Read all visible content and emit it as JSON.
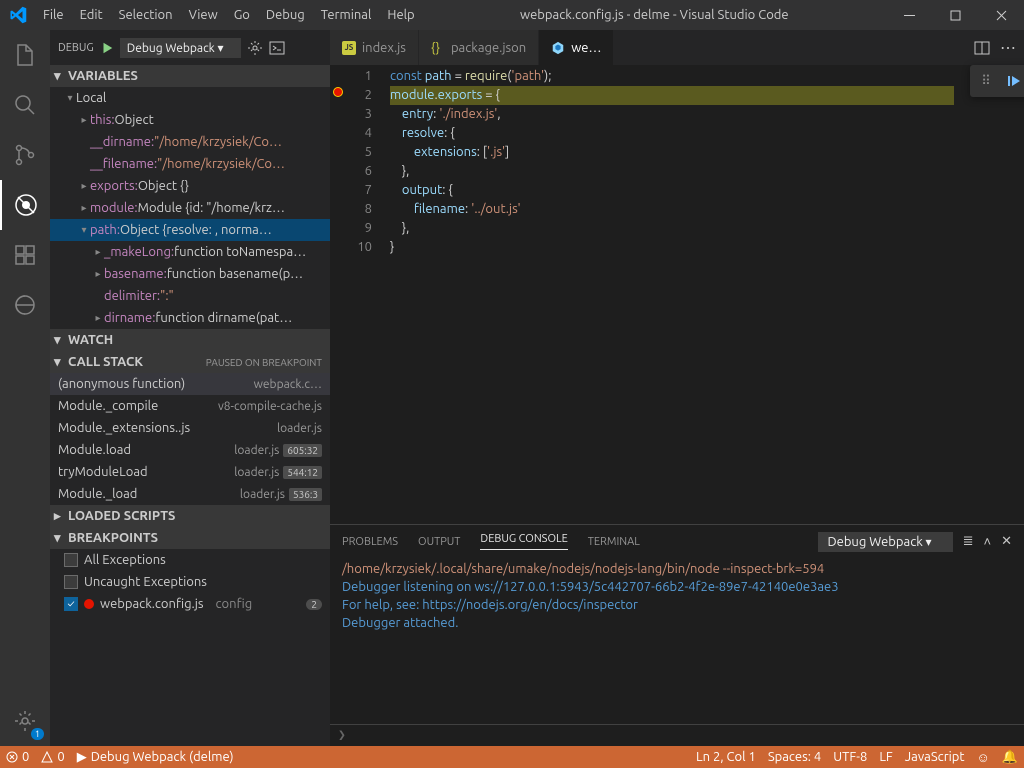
{
  "titlebar": {
    "title": "webpack.config.js - delme - Visual Studio Code",
    "menus": [
      "File",
      "Edit",
      "Selection",
      "View",
      "Go",
      "Debug",
      "Terminal",
      "Help"
    ]
  },
  "sidebar": {
    "debug_label": "DEBUG",
    "config": "Debug Webpack ▾"
  },
  "sections": {
    "variables": "VARIABLES",
    "watch": "WATCH",
    "callstack": "CALL STACK",
    "callstack_state": "PAUSED ON BREAKPOINT",
    "loaded": "LOADED SCRIPTS",
    "breakpoints": "BREAKPOINTS"
  },
  "variables": {
    "local": "Local",
    "rows": [
      {
        "n": "this:",
        "v": " Object"
      },
      {
        "n": "__dirname:",
        "v": " \"/home/krzysiek/Co…",
        "str": true
      },
      {
        "n": "__filename:",
        "v": " \"/home/krzysiek/Co…",
        "str": true
      },
      {
        "n": "exports:",
        "v": " Object {}"
      },
      {
        "n": "module:",
        "v": " Module {id: \"/home/krz…"
      },
      {
        "n": "path:",
        "v": " Object {resolve: , norma…",
        "sel": true,
        "exp": true
      },
      {
        "n": "_makeLong:",
        "v": " function toNamespa…",
        "sub": true
      },
      {
        "n": "basename:",
        "v": " function basename(p…",
        "sub": true
      },
      {
        "n": "delimiter:",
        "v": " \":\"",
        "sub": true,
        "str": true
      },
      {
        "n": "dirname:",
        "v": " function dirname(pat…",
        "sub": true
      }
    ]
  },
  "callstack": [
    {
      "n": "(anonymous function)",
      "f": "webpack.c…",
      "sel": true
    },
    {
      "n": "Module._compile",
      "f": "v8-compile-cache.js"
    },
    {
      "n": "Module._extensions..js",
      "f": "loader.js"
    },
    {
      "n": "Module.load",
      "f": "loader.js",
      "p": "605:32"
    },
    {
      "n": "tryModuleLoad",
      "f": "loader.js",
      "p": "544:12"
    },
    {
      "n": "Module._load",
      "f": "loader.js",
      "p": "536:3"
    }
  ],
  "breakpoints": {
    "all": "All Exceptions",
    "allchk": false,
    "uncaught": "Uncaught Exceptions",
    "uncaughtchk": false,
    "file": "webpack.config.js",
    "filecfg": "config",
    "filechk": true,
    "badge": "2"
  },
  "tabs": [
    {
      "label": "index.js",
      "icon": "js"
    },
    {
      "label": "package.json",
      "icon": "json"
    },
    {
      "label": "we…",
      "icon": "webpack",
      "active": true
    }
  ],
  "code": {
    "lines": [
      1,
      2,
      3,
      4,
      5,
      6,
      7,
      8,
      9,
      10
    ],
    "l1": {
      "a": "const",
      "b": " path ",
      "c": "=",
      "d": " require",
      "e": "(",
      "f": "'path'",
      "g": ");"
    },
    "l2": {
      "a": "module",
      "b": ".",
      "c": "exports",
      "d": " = ",
      "e": "{"
    },
    "l3": {
      "a": "    entry",
      "b": ": ",
      "c": "'./index.js'",
      "d": ","
    },
    "l4": {
      "a": "    resolve",
      "b": ": ",
      "c": "{"
    },
    "l5": {
      "a": "        extensions",
      "b": ": [",
      "c": "'.js'",
      "d": "]"
    },
    "l6": {
      "a": "    },"
    },
    "l7": {
      "a": "    output",
      "b": ": ",
      "c": "{"
    },
    "l8": {
      "a": "        filename",
      "b": ": ",
      "c": "'../out.js'"
    },
    "l9": {
      "a": "    },"
    },
    "l10": {
      "a": "}"
    }
  },
  "panel": {
    "tabs": [
      "PROBLEMS",
      "OUTPUT",
      "DEBUG CONSOLE",
      "TERMINAL"
    ],
    "selector": "Debug Webpack",
    "lines": [
      "/home/krzysiek/.local/share/umake/nodejs/nodejs-lang/bin/node --inspect-brk=594",
      "Debugger listening on ws://127.0.0.1:5943/5c442707-66b2-4f2e-89e7-42140e0e3ae3",
      "For help, see: https://nodejs.org/en/docs/inspector",
      "Debugger attached."
    ],
    "prompt": "❯"
  },
  "statusbar": {
    "errors": "0",
    "warnings": "0",
    "debug": "Debug Webpack (delme)",
    "ln": "Ln 2, Col 1",
    "spaces": "Spaces: 4",
    "enc": "UTF-8",
    "eol": "LF",
    "lang": "JavaScript"
  },
  "badge_gear": "1"
}
